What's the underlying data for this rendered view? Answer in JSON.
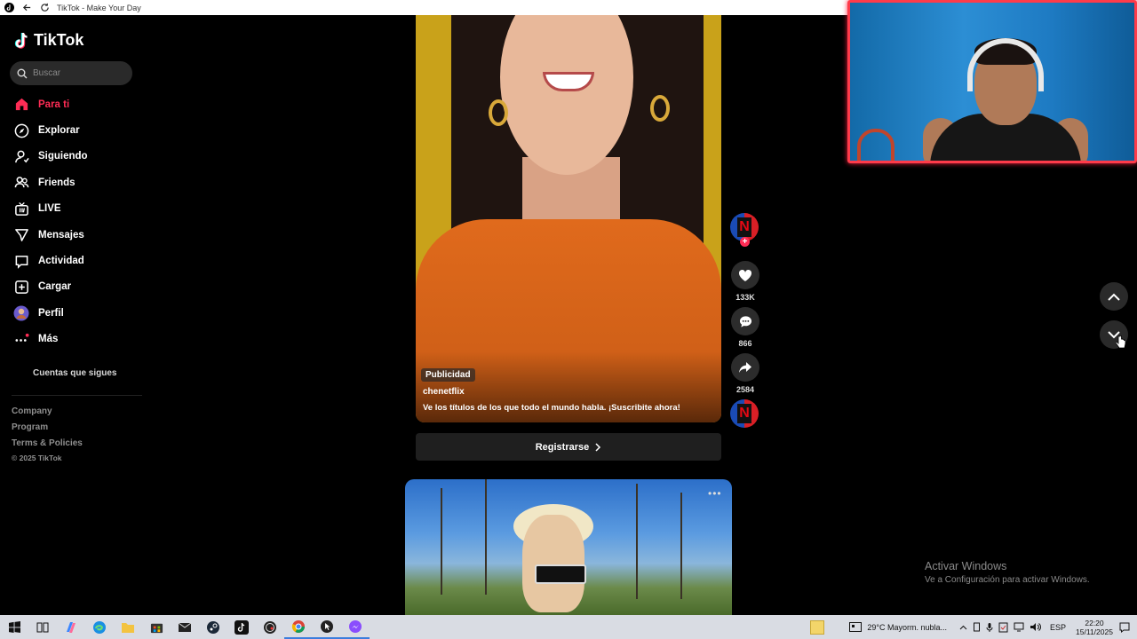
{
  "browser": {
    "title": "TikTok - Make Your Day"
  },
  "sidebar": {
    "logo": "TikTok",
    "search_placeholder": "Buscar",
    "items": [
      {
        "label": "Para ti",
        "icon": "home-icon",
        "active": true
      },
      {
        "label": "Explorar",
        "icon": "compass-icon"
      },
      {
        "label": "Siguiendo",
        "icon": "following-icon"
      },
      {
        "label": "Friends",
        "icon": "friends-icon"
      },
      {
        "label": "LIVE",
        "icon": "live-icon"
      },
      {
        "label": "Mensajes",
        "icon": "messages-icon"
      },
      {
        "label": "Actividad",
        "icon": "activity-icon"
      },
      {
        "label": "Cargar",
        "icon": "upload-icon"
      },
      {
        "label": "Perfil",
        "icon": "avatar"
      },
      {
        "label": "Más",
        "icon": "more-icon"
      }
    ],
    "following_header": "Cuentas que sigues",
    "footer": {
      "company": "Company",
      "program": "Program",
      "terms": "Terms & Policies",
      "copyright": "© 2025 TikTok"
    }
  },
  "feed": {
    "ad": {
      "badge": "Publicidad",
      "author": "chenetflix",
      "description": "Ve los títulos de los que todo el mundo habla. ¡Suscribite ahora!",
      "cta": "Registrarse",
      "avatar_letter": "N",
      "likes": "133K",
      "comments": "866",
      "shares": "2584"
    }
  },
  "windows": {
    "activate_title": "Activar Windows",
    "activate_sub": "Ve a Configuración para activar Windows.",
    "weather": "29°C  Mayorm. nubla...",
    "lang": "ESP",
    "time": "22:20",
    "date": "15/11/2025"
  },
  "colors": {
    "accent": "#fe2c55",
    "taskbar": "#d9dce3"
  }
}
